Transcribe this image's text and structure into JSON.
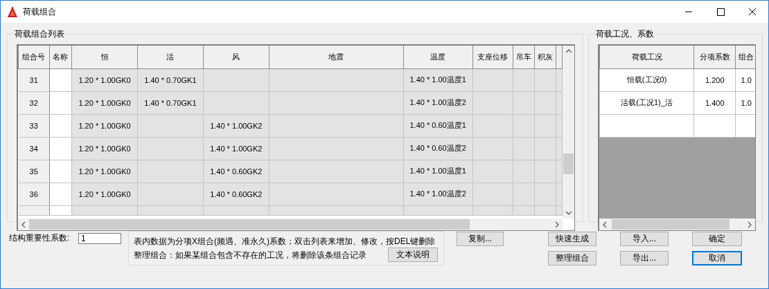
{
  "window": {
    "title": "荷载组合"
  },
  "combo_list": {
    "title": "荷载组合列表",
    "columns": [
      "组合号",
      "名称",
      "恒",
      "活",
      "风",
      "地震",
      "温度",
      "支座位移",
      "吊车",
      "积灰"
    ],
    "rows": [
      {
        "cells": [
          "31",
          null,
          "1.20 * 1.00GK0",
          "1.40 * 0.70GK1",
          null,
          null,
          "1.40 * 1.00温度1",
          null,
          null,
          null
        ]
      },
      {
        "cells": [
          "32",
          null,
          "1.20 * 1.00GK0",
          "1.40 * 0.70GK1",
          null,
          null,
          "1.40 * 1.00温度2",
          null,
          null,
          null
        ]
      },
      {
        "cells": [
          "33",
          null,
          "1.20 * 1.00GK0",
          null,
          "1.40 * 1.00GK2",
          null,
          "1.40 * 0.60温度1",
          null,
          null,
          null
        ]
      },
      {
        "cells": [
          "34",
          null,
          "1.20 * 1.00GK0",
          null,
          "1.40 * 1.00GK2",
          null,
          "1.40 * 0.60温度2",
          null,
          null,
          null
        ]
      },
      {
        "cells": [
          "35",
          null,
          "1.20 * 1.00GK0",
          null,
          "1.40 * 0.60GK2",
          null,
          "1.40 * 1.00温度1",
          null,
          null,
          null
        ]
      },
      {
        "cells": [
          "36",
          null,
          "1.20 * 1.00GK0",
          null,
          "1.40 * 0.60GK2",
          null,
          "1.40 * 1.00温度2",
          null,
          null,
          null
        ]
      }
    ]
  },
  "load_cases": {
    "title": "荷载工况、系数",
    "columns": [
      "荷载工况",
      "分项系数",
      "组合"
    ],
    "rows": [
      {
        "cells": [
          "恒载(工况0)",
          "1.200",
          "1.0"
        ]
      },
      {
        "cells": [
          "活载(工况1)_活",
          "1.400",
          "1.0"
        ]
      }
    ]
  },
  "importance": {
    "label": "结构重要性系数:",
    "value": "1"
  },
  "note": {
    "lines": [
      "表内数据为分项X组合(频遇、准永久)系数；双击列表来增加、修改，按DEL键删除",
      "整理组合：如果某组合包含不存在的工况，将删除该条组合记录"
    ],
    "button": "文本说明"
  },
  "actions": [
    {
      "label": "复制...",
      "focused": false
    },
    {
      "label": "快速生成",
      "focused": false
    },
    {
      "label": "导入...",
      "focused": false
    },
    {
      "label": "确定",
      "focused": false
    },
    {
      "label": "整理组合",
      "focused": false
    },
    {
      "label": "导出...",
      "focused": false
    },
    {
      "label": "取消",
      "focused": true
    }
  ]
}
